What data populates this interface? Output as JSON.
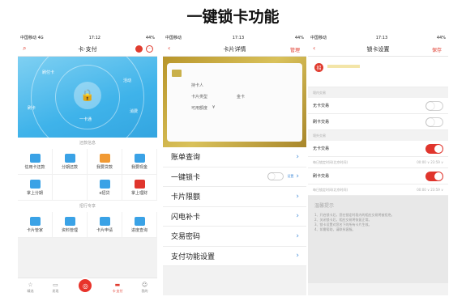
{
  "title": "一键锁卡功能",
  "screen1": {
    "status": {
      "carrier": "中国移动",
      "network": "4G",
      "time": "17:12",
      "battery": "44%"
    },
    "nav_title": "卡·支付",
    "hero_labels": [
      "刷付卡",
      "活动",
      "刷卡",
      "消费",
      "快捷"
    ],
    "hero_center": "一卡通",
    "section1": "还款信息",
    "grid1": [
      {
        "label": "信用卡还款",
        "color": "#3aa2e6"
      },
      {
        "label": "分期还款",
        "color": "#3aa2e6"
      },
      {
        "label": "我要贷款",
        "color": "#f19a34"
      },
      {
        "label": "我要现金",
        "color": "#3aa2e6"
      },
      {
        "label": "掌上分期",
        "color": "#3aa2e6"
      },
      {
        "label": "",
        "color": "#ffffff"
      },
      {
        "label": "e招贷",
        "color": "#3aa2e6"
      },
      {
        "label": "掌上理财",
        "color": "#e0352d"
      }
    ],
    "section2": "招行专享",
    "grid2": [
      {
        "label": "卡片管家",
        "color": "#3aa2e6"
      },
      {
        "label": "资料管理",
        "color": "#3aa2e6"
      },
      {
        "label": "卡片申请",
        "color": "#3aa2e6"
      },
      {
        "label": "进度查询",
        "color": "#3aa2e6"
      }
    ],
    "tabs": [
      "精选",
      "发现",
      "",
      "卡·支付",
      "我的"
    ]
  },
  "screen2": {
    "status": {
      "carrier": "中国移动",
      "time": "17:13",
      "battery": "44%"
    },
    "nav_title": "卡片详情",
    "nav_right": "管理",
    "card_rows": [
      {
        "label": "持卡人",
        "value": ""
      },
      {
        "label": "卡片类型",
        "value": "金卡"
      },
      {
        "label": "可用额度",
        "value": "¥"
      }
    ],
    "menu": [
      {
        "label": "账单查询"
      },
      {
        "label": "一键锁卡",
        "setting": "设置"
      },
      {
        "label": "卡片限额"
      },
      {
        "label": "闪电补卡"
      },
      {
        "label": "交易密码"
      },
      {
        "label": "支付功能设置"
      }
    ]
  },
  "screen3": {
    "status": {
      "carrier": "中国移动",
      "time": "17:13",
      "battery": "44%"
    },
    "nav_title": "锁卡设置",
    "nav_right": "保存",
    "group1_head": "境内交易",
    "group1": [
      {
        "label": "无卡交易",
        "on": false
      },
      {
        "label": "刷卡交易",
        "on": false
      }
    ],
    "group2_head": "境外交易",
    "group2": [
      {
        "label": "无卡交易",
        "on": true,
        "time_label": "每日锁定时间(北京时间)",
        "time_value": "00:00 ∨  23:59 ∨"
      },
      {
        "label": "刷卡交易",
        "on": true,
        "time_label": "每日锁定时间(北京时间)",
        "time_value": "00:00 ∨  23:59 ∨"
      }
    ],
    "tip_title": "温馨提示",
    "tip_lines": [
      "1、开启锁卡后，您在锁定时段内的相应交易将被拒绝。",
      "2、关闭锁卡后，相应交易将恢复正常。",
      "3、锁卡设置对您名下的所有卡片生效。",
      "4、如需帮助，请联系客服。"
    ]
  }
}
